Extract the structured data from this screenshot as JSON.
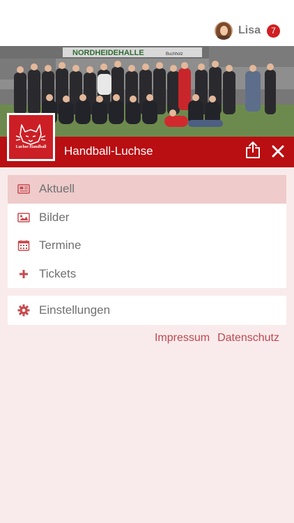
{
  "user": {
    "name": "Lisa",
    "notification_count": "7"
  },
  "hero": {
    "banner_text": "NORDHEIDEHALLE",
    "banner_subtext": "Buchholz"
  },
  "club": {
    "name": "Handball-Luchse",
    "logo_text": "Luchse Handball"
  },
  "menu": {
    "items": [
      {
        "label": "Aktuell",
        "icon": "newspaper-icon",
        "active": true
      },
      {
        "label": "Bilder",
        "icon": "image-icon",
        "active": false
      },
      {
        "label": "Termine",
        "icon": "calendar-icon",
        "active": false
      },
      {
        "label": "Tickets",
        "icon": "plus-icon",
        "active": false
      }
    ],
    "settings": {
      "label": "Einstellungen",
      "icon": "gear-icon"
    }
  },
  "footer": {
    "impressum": "Impressum",
    "datenschutz": "Datenschutz"
  },
  "colors": {
    "brand_red": "#b90e12",
    "accent_red": "#cc1f25",
    "badge_red": "#cf1f23",
    "active_row": "#efcbcb",
    "background": "#f9ebeb",
    "icon_red": "#c94a4f"
  }
}
